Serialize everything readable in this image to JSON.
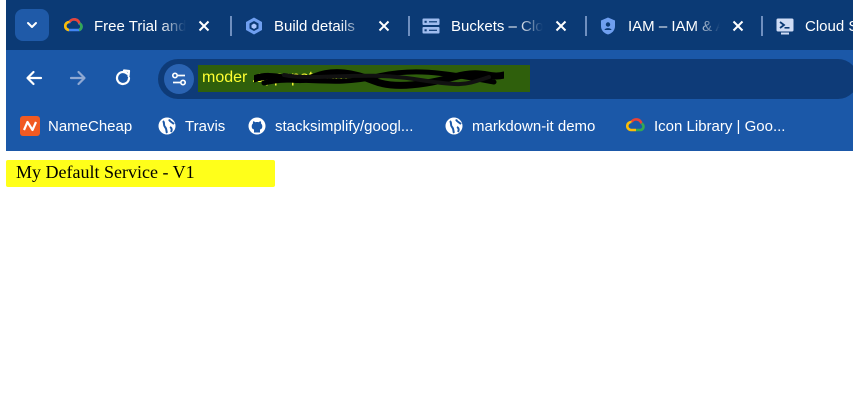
{
  "browser": {
    "tabs": [
      {
        "title": "Free Trial and Free Tier Services",
        "icon": "google-cloud-icon"
      },
      {
        "title": "Build details",
        "icon": "cloud-build-icon"
      },
      {
        "title": "Buckets – Cloud Storage",
        "icon": "buckets-icon"
      },
      {
        "title": "IAM – IAM & Admin",
        "icon": "iam-shield-icon"
      },
      {
        "title": "Cloud Shell",
        "icon": "cloud-shell-icon"
      }
    ],
    "address_bar": {
      "url": "moder                                    .appspot.com"
    },
    "bookmarks": [
      {
        "label": "NameCheap",
        "icon": "namecheap-icon"
      },
      {
        "label": "Travis",
        "icon": "globe-icon"
      },
      {
        "label": "stacksimplify/googl...",
        "icon": "github-icon"
      },
      {
        "label": "markdown-it demo",
        "icon": "globe-icon"
      },
      {
        "label": "Icon Library  |  Goo...",
        "icon": "google-cloud-icon"
      }
    ]
  },
  "page": {
    "heading": "My Default Service - V1"
  },
  "colors": {
    "tab_strip": "#0b3a75",
    "toolbar": "#1b58a8",
    "highlight_yellow": "#ffff1a"
  }
}
